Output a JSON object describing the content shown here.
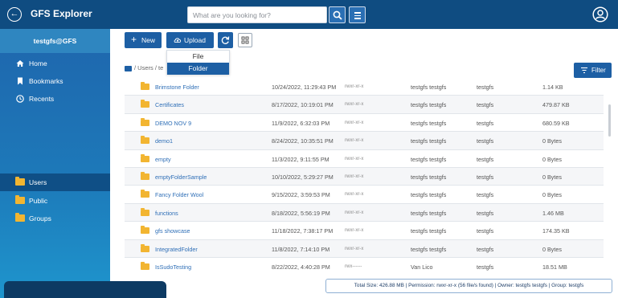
{
  "header": {
    "app_title": "GFS Explorer",
    "search_placeholder": "What are you looking for?",
    "search_value": ""
  },
  "sidebar": {
    "user_label": "testgfs@GFS",
    "nav": [
      {
        "label": "Home",
        "icon": "home-icon"
      },
      {
        "label": "Bookmarks",
        "icon": "bookmark-icon"
      },
      {
        "label": "Recents",
        "icon": "clock-icon"
      }
    ],
    "folders": [
      {
        "label": "Users",
        "active": true
      },
      {
        "label": "Public",
        "active": false
      },
      {
        "label": "Groups",
        "active": false
      }
    ]
  },
  "toolbar": {
    "new_label": "New",
    "upload_label": "Upload",
    "upload_menu": [
      {
        "label": "File"
      },
      {
        "label": "Folder"
      }
    ],
    "filter_label": "Filter"
  },
  "breadcrumb": {
    "text": "/ Users / te"
  },
  "files": [
    {
      "name": "Brimstone Folder",
      "modified": "10/24/2022, 11:29:43 PM",
      "permission": "rwxr-xr-x",
      "owner": "testgfs testgfs",
      "group": "testgfs",
      "size": "1.14 KB"
    },
    {
      "name": "Certificates",
      "modified": "8/17/2022, 10:19:01 PM",
      "permission": "rwxr-xr-x",
      "owner": "testgfs testgfs",
      "group": "testgfs",
      "size": "479.87 KB"
    },
    {
      "name": "DEMO NOV 9",
      "modified": "11/9/2022, 6:32:03 PM",
      "permission": "rwxr-xr-x",
      "owner": "testgfs testgfs",
      "group": "testgfs",
      "size": "680.59 KB"
    },
    {
      "name": "demo1",
      "modified": "8/24/2022, 10:35:51 PM",
      "permission": "rwxr-xr-x",
      "owner": "testgfs testgfs",
      "group": "testgfs",
      "size": "0 Bytes"
    },
    {
      "name": "empty",
      "modified": "11/3/2022, 9:11:55 PM",
      "permission": "rwxr-xr-x",
      "owner": "testgfs testgfs",
      "group": "testgfs",
      "size": "0 Bytes"
    },
    {
      "name": "emptyFolderSample",
      "modified": "10/10/2022, 5:29:27 PM",
      "permission": "rwxr-xr-x",
      "owner": "testgfs testgfs",
      "group": "testgfs",
      "size": "0 Bytes"
    },
    {
      "name": "Fancy Folder Wool",
      "modified": "9/15/2022, 3:59:53 PM",
      "permission": "rwxr-xr-x",
      "owner": "testgfs testgfs",
      "group": "testgfs",
      "size": "0 Bytes"
    },
    {
      "name": "functions",
      "modified": "8/18/2022, 5:56:19 PM",
      "permission": "rwxr-xr-x",
      "owner": "testgfs testgfs",
      "group": "testgfs",
      "size": "1.46 MB"
    },
    {
      "name": "gfs showcase",
      "modified": "11/18/2022, 7:38:17 PM",
      "permission": "rwxr-xr-x",
      "owner": "testgfs testgfs",
      "group": "testgfs",
      "size": "174.35 KB"
    },
    {
      "name": "IntegratedFolder",
      "modified": "11/8/2022, 7:14:10 PM",
      "permission": "rwxr-xr-x",
      "owner": "testgfs testgfs",
      "group": "testgfs",
      "size": "0 Bytes"
    },
    {
      "name": "IsSudoTesting",
      "modified": "8/22/2022, 4:40:28 PM",
      "permission": "rwx------",
      "owner": "Van Lico",
      "group": "testgfs",
      "size": "18.51 MB"
    }
  ],
  "status_bar": {
    "text": "Total Size: 426.88 MB | Permission: rwxr-xr-x (56 file/s found) | Owner: testgfs testgfs | Group: testgfs"
  },
  "colors": {
    "header_bg": "#0f4c81",
    "accent": "#1d5fa4",
    "folder": "#f2b531",
    "link": "#2f6fb7"
  }
}
